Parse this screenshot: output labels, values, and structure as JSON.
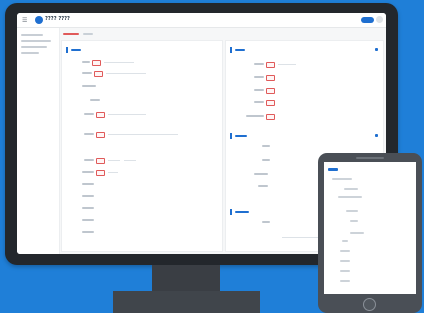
{
  "app": {
    "name": "???? ????"
  },
  "colors": {
    "background": "#1f7fd8",
    "accent": "#1f6fd0",
    "required": "#e05a5a",
    "monitor_bezel": "#23272c",
    "tablet_body": "#4a4f56"
  },
  "icons": {
    "menu": "hamburger-icon",
    "logo": "logo-circle-icon",
    "edit": "pencil-icon",
    "avatar": "user-avatar-icon"
  }
}
